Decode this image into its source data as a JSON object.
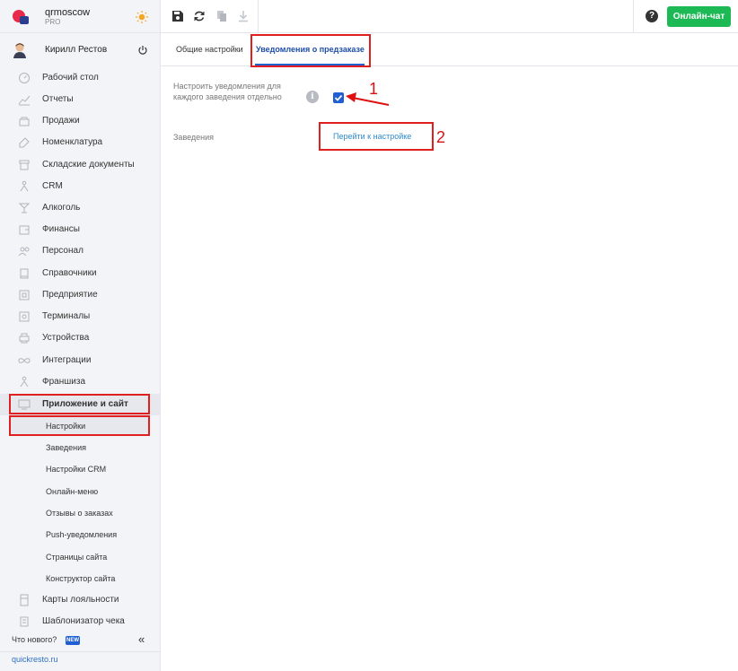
{
  "brand": {
    "name": "qrmoscow",
    "plan": "PRO"
  },
  "user": {
    "name": "Кирилл Рестов"
  },
  "nav": [
    {
      "label": "Рабочий стол",
      "icon": "dashboard-icon"
    },
    {
      "label": "Отчеты",
      "icon": "chart-icon"
    },
    {
      "label": "Продажи",
      "icon": "cart-icon"
    },
    {
      "label": "Номенклатура",
      "icon": "tag-icon"
    },
    {
      "label": "Складские документы",
      "icon": "box-icon"
    },
    {
      "label": "CRM",
      "icon": "people-icon"
    },
    {
      "label": "Алкоголь",
      "icon": "glass-icon"
    },
    {
      "label": "Финансы",
      "icon": "wallet-icon"
    },
    {
      "label": "Персонал",
      "icon": "staff-icon"
    },
    {
      "label": "Справочники",
      "icon": "book-icon"
    },
    {
      "label": "Предприятие",
      "icon": "building-icon"
    },
    {
      "label": "Терминалы",
      "icon": "terminal-icon"
    },
    {
      "label": "Устройства",
      "icon": "printer-icon"
    },
    {
      "label": "Интеграции",
      "icon": "infinity-icon"
    },
    {
      "label": "Франшиза",
      "icon": "network-icon"
    },
    {
      "label": "Приложение и сайт",
      "icon": "monitor-icon"
    }
  ],
  "subnav": [
    {
      "label": "Настройки"
    },
    {
      "label": "Заведения"
    },
    {
      "label": "Настройки CRM"
    },
    {
      "label": "Онлайн-меню"
    },
    {
      "label": "Отзывы о заказах"
    },
    {
      "label": "Push-уведомления"
    },
    {
      "label": "Страницы сайта"
    },
    {
      "label": "Конструктор сайта"
    }
  ],
  "nav_after": [
    {
      "label": "Карты лояльности",
      "icon": "card-icon"
    },
    {
      "label": "Шаблонизатор чека",
      "icon": "receipt-icon"
    }
  ],
  "footer": {
    "news": "Что нового?",
    "badge": "NEW",
    "collapse": "«",
    "site": "quickresto.ru"
  },
  "toolbar": {
    "help": "?",
    "chat": "Онлайн-чат"
  },
  "tabs": {
    "general": "Общие настройки",
    "notifications": "Уведомления о предзаказе"
  },
  "content": {
    "setting_label": "Настроить уведомления для каждого заведения отдельно",
    "info": "i",
    "checkbox_checked": true,
    "venues_label": "Заведения",
    "venues_link": "Перейти к настройке"
  },
  "annotations": {
    "one": "1",
    "two": "2"
  },
  "colors": {
    "accent": "#1f5fd1",
    "highlight": "#e02020",
    "chat": "#1db954"
  }
}
